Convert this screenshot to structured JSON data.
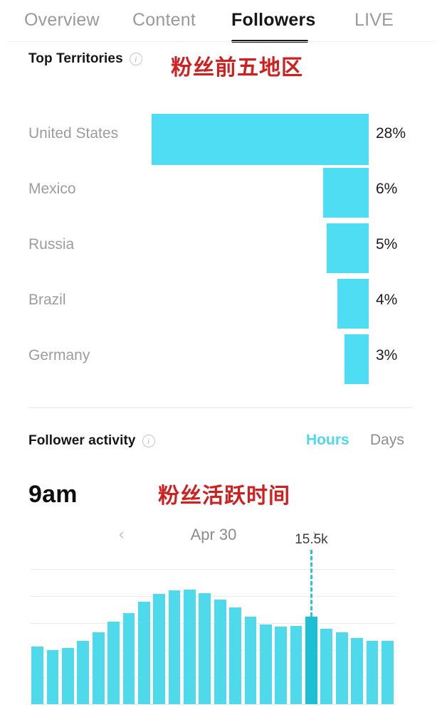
{
  "tabs": [
    {
      "label": "Overview",
      "active": false
    },
    {
      "label": "Content",
      "active": false
    },
    {
      "label": "Followers",
      "active": true
    },
    {
      "label": "LIVE",
      "active": false
    }
  ],
  "territories_section": {
    "title": "Top Territories",
    "info_icon": "info-icon",
    "annotation": "粉丝前五地区",
    "annotation_color": "#cf2020"
  },
  "activity_section": {
    "title": "Follower activity",
    "info_icon": "info-icon",
    "annotation": "粉丝活跃时间",
    "toggle": [
      {
        "label": "Hours",
        "active": true
      },
      {
        "label": "Days",
        "active": false
      }
    ],
    "peak_hour": "9am",
    "date": "Apr 30",
    "prev_icon": "chevron-left-icon",
    "next_icon": "chevron-right-icon",
    "tooltip_value": "15.5k"
  },
  "colors": {
    "bar": "#4eddf2",
    "bar_highlight": "#1dbfd4",
    "accent": "#4fd8e8",
    "text_primary": "#16161a",
    "text_muted": "#9c9c9c"
  },
  "chart_data": [
    {
      "type": "bar",
      "orientation": "horizontal",
      "title": "Top Territories",
      "categories": [
        "United States",
        "Mexico",
        "Russia",
        "Brazil",
        "Germany"
      ],
      "values": [
        28,
        6,
        5,
        4,
        3
      ],
      "value_labels": [
        "28%",
        "6%",
        "5%",
        "4%",
        "3%"
      ],
      "unit": "%",
      "xlabel": "",
      "ylabel": "",
      "grid": false,
      "legend": "none"
    },
    {
      "type": "bar",
      "orientation": "vertical",
      "title": "Follower activity",
      "subtitle": "Apr 30",
      "peak_label": "9am",
      "x": [
        "0",
        "1",
        "2",
        "3",
        "4",
        "5",
        "6",
        "7",
        "8",
        "9",
        "10",
        "11",
        "12",
        "13",
        "14",
        "15",
        "16",
        "17",
        "18",
        "19",
        "20",
        "21",
        "22",
        "23"
      ],
      "values": [
        10.2,
        9.6,
        10.0,
        11.2,
        12.8,
        14.6,
        16.2,
        18.2,
        19.6,
        20.2,
        20.3,
        19.7,
        18.6,
        17.2,
        15.6,
        14.1,
        13.8,
        13.9,
        15.5,
        13.4,
        12.8,
        11.7,
        11.3,
        11.2
      ],
      "highlight_index": 18,
      "annotation": {
        "value": "15.5k",
        "index": 18,
        "line": "dashed"
      },
      "ylim": [
        0,
        24
      ],
      "gridlines": 6,
      "grid": true,
      "legend": "none"
    }
  ]
}
